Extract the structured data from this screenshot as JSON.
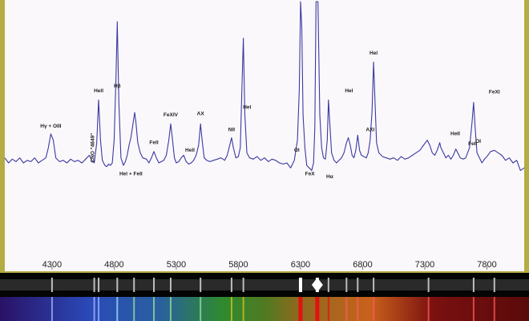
{
  "chart_data": {
    "type": "line",
    "xlim": [
      3920,
      8100
    ],
    "ylim": [
      0,
      100
    ],
    "xticks": [
      4300,
      4800,
      5300,
      5800,
      6300,
      6800,
      7300,
      7800
    ],
    "xtick_labels": [
      "4300",
      "4800",
      "5300",
      "5800",
      "6300",
      "6800",
      "7300",
      "7800"
    ],
    "grid": false,
    "series_color": "#3a3aa0",
    "series": [
      {
        "points": [
          [
            3920,
            38
          ],
          [
            3950,
            36
          ],
          [
            3980,
            37.5
          ],
          [
            4010,
            36.5
          ],
          [
            4040,
            38
          ],
          [
            4070,
            36
          ],
          [
            4100,
            37
          ],
          [
            4130,
            36.5
          ],
          [
            4160,
            38
          ],
          [
            4190,
            36
          ],
          [
            4220,
            37
          ],
          [
            4250,
            38
          ],
          [
            4270,
            42
          ],
          [
            4290,
            47.5
          ],
          [
            4310,
            45
          ],
          [
            4330,
            38
          ],
          [
            4360,
            36.5
          ],
          [
            4390,
            37
          ],
          [
            4420,
            36
          ],
          [
            4450,
            37.5
          ],
          [
            4480,
            36.5
          ],
          [
            4510,
            37
          ],
          [
            4540,
            36
          ],
          [
            4570,
            37.5
          ],
          [
            4600,
            39
          ],
          [
            4620,
            37
          ],
          [
            4640,
            36
          ],
          [
            4660,
            44
          ],
          [
            4675,
            61
          ],
          [
            4690,
            45
          ],
          [
            4705,
            37
          ],
          [
            4725,
            35
          ],
          [
            4740,
            34.5
          ],
          [
            4755,
            35.5
          ],
          [
            4770,
            35
          ],
          [
            4785,
            36
          ],
          [
            4800,
            45
          ],
          [
            4815,
            70
          ],
          [
            4825,
            92
          ],
          [
            4838,
            60
          ],
          [
            4855,
            38
          ],
          [
            4875,
            35
          ],
          [
            4890,
            36.5
          ],
          [
            4905,
            39
          ],
          [
            4920,
            43
          ],
          [
            4935,
            46
          ],
          [
            4950,
            51
          ],
          [
            4965,
            56
          ],
          [
            4975,
            52
          ],
          [
            4990,
            44
          ],
          [
            5010,
            40
          ],
          [
            5030,
            38
          ],
          [
            5060,
            37.5
          ],
          [
            5080,
            36
          ],
          [
            5100,
            38
          ],
          [
            5120,
            40.5
          ],
          [
            5140,
            38
          ],
          [
            5160,
            36
          ],
          [
            5180,
            36.5
          ],
          [
            5200,
            37
          ],
          [
            5220,
            39
          ],
          [
            5240,
            45
          ],
          [
            5255,
            51.5
          ],
          [
            5270,
            45
          ],
          [
            5285,
            38
          ],
          [
            5300,
            36
          ],
          [
            5320,
            36.5
          ],
          [
            5340,
            38
          ],
          [
            5360,
            39
          ],
          [
            5380,
            36.5
          ],
          [
            5400,
            35.5
          ],
          [
            5420,
            36
          ],
          [
            5440,
            37
          ],
          [
            5460,
            39
          ],
          [
            5480,
            43
          ],
          [
            5495,
            51.5
          ],
          [
            5510,
            44
          ],
          [
            5525,
            38
          ],
          [
            5545,
            37
          ],
          [
            5570,
            36.5
          ],
          [
            5600,
            37
          ],
          [
            5630,
            37.5
          ],
          [
            5660,
            38
          ],
          [
            5690,
            37
          ],
          [
            5710,
            39
          ],
          [
            5730,
            43
          ],
          [
            5745,
            46
          ],
          [
            5760,
            42
          ],
          [
            5780,
            38
          ],
          [
            5800,
            38.5
          ],
          [
            5815,
            42
          ],
          [
            5828,
            65
          ],
          [
            5840,
            85.5
          ],
          [
            5852,
            55
          ],
          [
            5868,
            40
          ],
          [
            5890,
            38
          ],
          [
            5920,
            37.5
          ],
          [
            5950,
            38.5
          ],
          [
            5980,
            37
          ],
          [
            6010,
            38
          ],
          [
            6040,
            36.5
          ],
          [
            6070,
            37.5
          ],
          [
            6100,
            37
          ],
          [
            6130,
            36
          ],
          [
            6160,
            35.5
          ],
          [
            6190,
            36
          ],
          [
            6220,
            34
          ],
          [
            6250,
            37
          ],
          [
            6275,
            45
          ],
          [
            6290,
            65
          ],
          [
            6300,
            100
          ],
          [
            6310,
            90
          ],
          [
            6320,
            55
          ],
          [
            6335,
            42
          ],
          [
            6350,
            35
          ],
          [
            6370,
            34
          ],
          [
            6390,
            33
          ],
          [
            6405,
            36
          ],
          [
            6415,
            50
          ],
          [
            6425,
            100
          ],
          [
            6440,
            100
          ],
          [
            6455,
            55
          ],
          [
            6470,
            42
          ],
          [
            6485,
            38
          ],
          [
            6500,
            37.5
          ],
          [
            6515,
            45
          ],
          [
            6525,
            61
          ],
          [
            6535,
            52
          ],
          [
            6550,
            40
          ],
          [
            6570,
            37
          ],
          [
            6590,
            36
          ],
          [
            6610,
            37
          ],
          [
            6630,
            38
          ],
          [
            6650,
            40
          ],
          [
            6670,
            44
          ],
          [
            6685,
            46
          ],
          [
            6700,
            43
          ],
          [
            6715,
            39
          ],
          [
            6730,
            38
          ],
          [
            6745,
            41
          ],
          [
            6760,
            47
          ],
          [
            6775,
            41
          ],
          [
            6790,
            39
          ],
          [
            6810,
            38.5
          ],
          [
            6830,
            38
          ],
          [
            6845,
            40
          ],
          [
            6860,
            45
          ],
          [
            6875,
            56
          ],
          [
            6888,
            76
          ],
          [
            6898,
            62
          ],
          [
            6912,
            44
          ],
          [
            6930,
            40
          ],
          [
            6960,
            38.5
          ],
          [
            6990,
            38
          ],
          [
            7020,
            37.5
          ],
          [
            7050,
            38
          ],
          [
            7080,
            37
          ],
          [
            7110,
            38.5
          ],
          [
            7140,
            37.5
          ],
          [
            7170,
            38
          ],
          [
            7200,
            39
          ],
          [
            7230,
            40
          ],
          [
            7260,
            41
          ],
          [
            7290,
            43
          ],
          [
            7320,
            45
          ],
          [
            7340,
            43
          ],
          [
            7360,
            40
          ],
          [
            7380,
            39
          ],
          [
            7400,
            41
          ],
          [
            7420,
            44
          ],
          [
            7430,
            42
          ],
          [
            7450,
            40
          ],
          [
            7470,
            38
          ],
          [
            7490,
            39
          ],
          [
            7510,
            37.5
          ],
          [
            7530,
            39
          ],
          [
            7550,
            41.5
          ],
          [
            7565,
            40
          ],
          [
            7585,
            38
          ],
          [
            7610,
            37.5
          ],
          [
            7630,
            38
          ],
          [
            7660,
            42
          ],
          [
            7680,
            52
          ],
          [
            7693,
            60
          ],
          [
            7705,
            50
          ],
          [
            7720,
            40
          ],
          [
            7740,
            38
          ],
          [
            7760,
            36
          ],
          [
            7780,
            37.5
          ],
          [
            7800,
            38.5
          ],
          [
            7830,
            40.5
          ],
          [
            7860,
            41
          ],
          [
            7890,
            40
          ],
          [
            7920,
            39
          ],
          [
            7950,
            37
          ],
          [
            7980,
            38
          ],
          [
            8010,
            36
          ],
          [
            8040,
            37
          ],
          [
            8070,
            33
          ],
          [
            8100,
            34
          ]
        ]
      }
    ],
    "annotations": [
      {
        "text": "Hγ + OIII",
        "x": 4290,
        "y": 50,
        "rotate": false
      },
      {
        "text": "Hell",
        "x": 4675,
        "y": 64,
        "rotate": false
      },
      {
        "text": "CNO \"4649\"",
        "x": 4640,
        "y": 42,
        "rotate": true
      },
      {
        "text": "Hβ",
        "x": 4825,
        "y": 66,
        "rotate": false
      },
      {
        "text": "Hel + FeII",
        "x": 4935,
        "y": 31,
        "rotate": false
      },
      {
        "text": "FeII",
        "x": 5120,
        "y": 43.5,
        "rotate": false
      },
      {
        "text": "FeXIV",
        "x": 5255,
        "y": 54.5,
        "rotate": false
      },
      {
        "text": "Hell",
        "x": 5410,
        "y": 40.5,
        "rotate": false
      },
      {
        "text": "AX",
        "x": 5495,
        "y": 55,
        "rotate": false
      },
      {
        "text": "NII",
        "x": 5745,
        "y": 48.5,
        "rotate": false
      },
      {
        "text": "Hel",
        "x": 5870,
        "y": 57.5,
        "rotate": false
      },
      {
        "text": "OI",
        "x": 6270,
        "y": 40.5,
        "rotate": false
      },
      {
        "text": "FeX",
        "x": 6375,
        "y": 31,
        "rotate": false
      },
      {
        "text": "Hα",
        "x": 6535,
        "y": 30,
        "rotate": false
      },
      {
        "text": "Hel",
        "x": 6690,
        "y": 64,
        "rotate": false
      },
      {
        "text": "AXI",
        "x": 6860,
        "y": 48.5,
        "rotate": false
      },
      {
        "text": "Hel",
        "x": 6888,
        "y": 79,
        "rotate": false
      },
      {
        "text": "HeII",
        "x": 7545,
        "y": 47,
        "rotate": false
      },
      {
        "text": "FeII",
        "x": 7685,
        "y": 43,
        "rotate": false
      },
      {
        "text": "OI",
        "x": 7730,
        "y": 44,
        "rotate": false
      },
      {
        "text": "FeXI",
        "x": 7860,
        "y": 63.5,
        "rotate": false
      }
    ]
  },
  "spectrum_strips": {
    "emission_lines": [
      4300,
      4640,
      4675,
      4825,
      4960,
      5120,
      5255,
      5495,
      5745,
      5840,
      6300,
      6435,
      6525,
      6670,
      6760,
      6888,
      7330,
      7693,
      7860
    ],
    "bright_lines": [
      6300,
      6435
    ],
    "colors": {
      "violet": "#2a1266",
      "blue": "#2a4ab8",
      "cyan": "#9fe6ff",
      "green": "#2e8a2e",
      "yellow": "#d7c72a",
      "orange": "#c9611c",
      "red": "#e01212",
      "dark_red": "#5a0a0a"
    }
  }
}
